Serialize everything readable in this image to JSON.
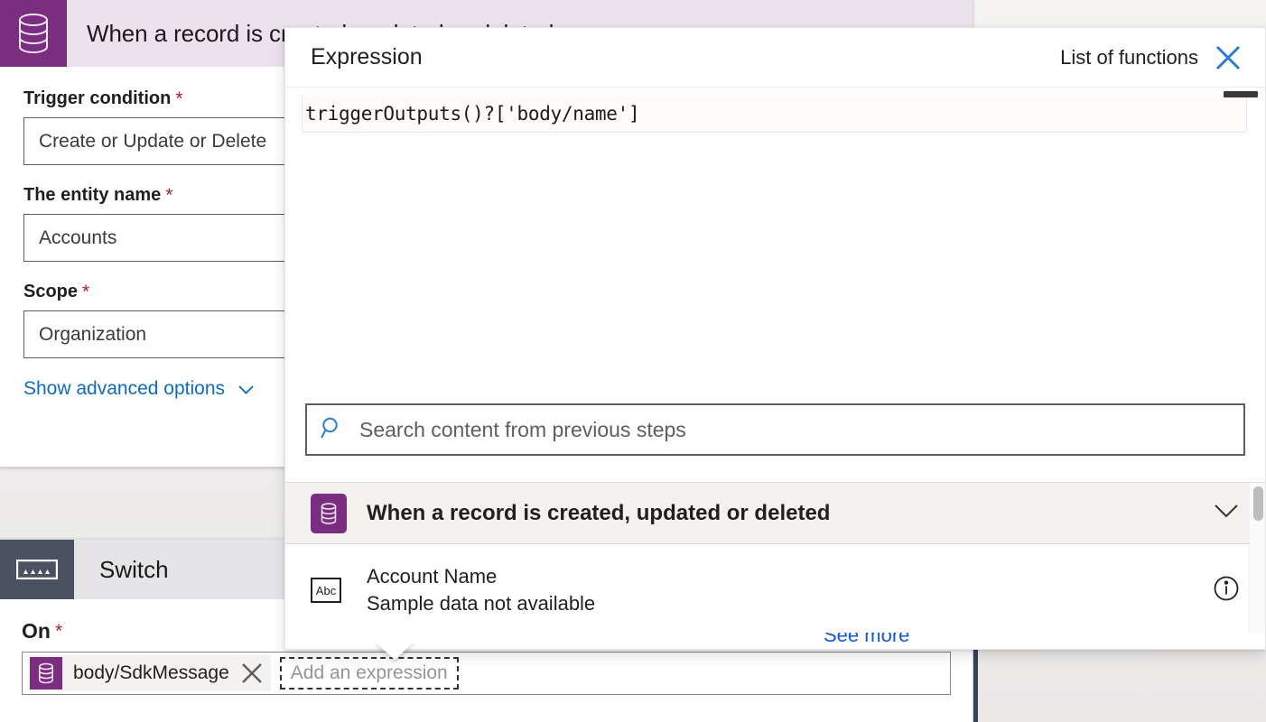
{
  "colors": {
    "trigger_purple": "#7b2d80",
    "trigger_header_bg": "#ece2ee",
    "switch_icon_bg": "#4a5160",
    "accent_blue": "#0f6cbd",
    "required_red": "#a4262c",
    "link_blue": "#1757d6"
  },
  "trigger_card": {
    "icon": "database-icon",
    "title": "When a record is created, updated or deleted",
    "fields": [
      {
        "label": "Trigger condition",
        "required": "*",
        "value": "Create or Update or Delete",
        "name": "trigger-condition"
      },
      {
        "label": "The entity name",
        "required": "*",
        "value": "Accounts",
        "name": "entity-name"
      },
      {
        "label": "Scope",
        "required": "*",
        "value": "Organization",
        "name": "scope"
      }
    ],
    "advanced_options_label": "Show advanced options",
    "advanced_options_icon": "chevron-down-icon"
  },
  "switch_card": {
    "icon": "switch-icon",
    "title": "Switch",
    "on_label": "On",
    "on_required": "*",
    "token": {
      "icon": "database-icon",
      "label": "body/SdkMessage",
      "remove_icon": "close-icon"
    },
    "add_expression_placeholder": "Add an expression"
  },
  "flyout": {
    "title": "Expression",
    "list_of_functions_label": "List of functions",
    "close_icon": "close-icon",
    "expression_value": "triggerOutputs()?['body/name']",
    "search": {
      "icon": "search-icon",
      "placeholder": "Search content from previous steps",
      "value": ""
    },
    "results": {
      "group": {
        "icon": "database-icon",
        "label": "When a record is created, updated or deleted",
        "collapse_icon": "chevron-down-icon"
      },
      "items": [
        {
          "icon": "abc-text-icon",
          "icon_text": "Abc",
          "title": "Account Name",
          "subtitle": "Sample data not available",
          "info_icon": "info-icon"
        }
      ]
    },
    "footer_link": "See more"
  }
}
